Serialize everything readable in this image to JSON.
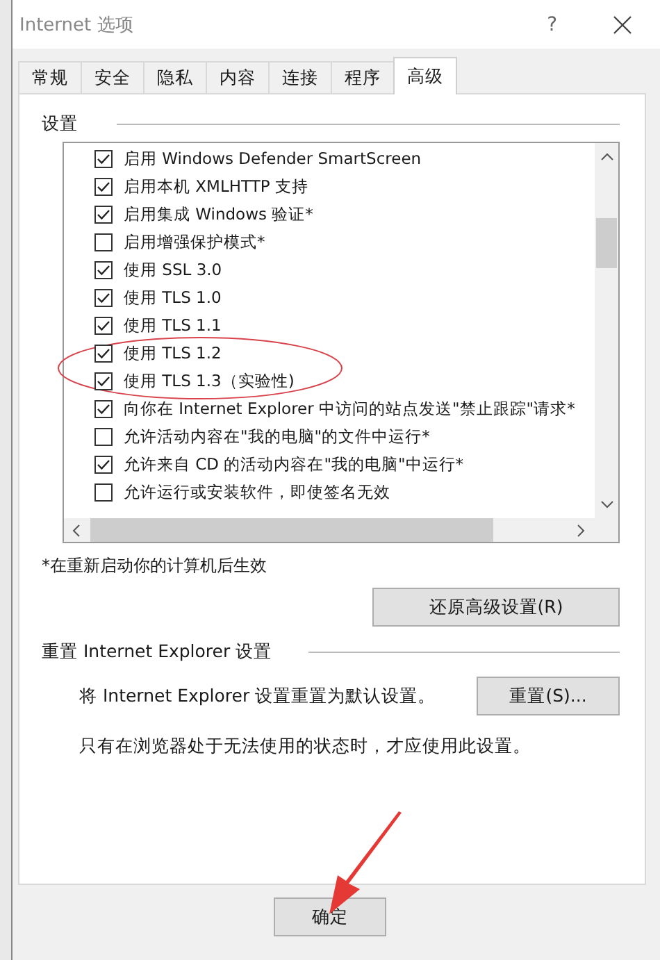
{
  "window": {
    "title": "Internet 选项",
    "help": "?"
  },
  "tabs": [
    {
      "label": "常规",
      "selected": false
    },
    {
      "label": "安全",
      "selected": false
    },
    {
      "label": "隐私",
      "selected": false
    },
    {
      "label": "内容",
      "selected": false
    },
    {
      "label": "连接",
      "selected": false
    },
    {
      "label": "程序",
      "selected": false
    },
    {
      "label": "高级",
      "selected": true
    }
  ],
  "settings": {
    "title": "设置",
    "items": [
      {
        "label": "启用 Windows Defender SmartScreen",
        "checked": true
      },
      {
        "label": "启用本机 XMLHTTP 支持",
        "checked": true
      },
      {
        "label": "启用集成 Windows 验证*",
        "checked": true
      },
      {
        "label": "启用增强保护模式*",
        "checked": false
      },
      {
        "label": "使用 SSL 3.0",
        "checked": true
      },
      {
        "label": "使用 TLS 1.0",
        "checked": true
      },
      {
        "label": "使用 TLS 1.1",
        "checked": true
      },
      {
        "label": "使用 TLS 1.2",
        "checked": true
      },
      {
        "label": "使用 TLS 1.3（实验性)",
        "checked": true
      },
      {
        "label": "向你在 Internet Explorer 中访问的站点发送\"禁止跟踪\"请求*",
        "checked": true
      },
      {
        "label": "允许活动内容在\"我的电脑\"的文件中运行*",
        "checked": false
      },
      {
        "label": "允许来自 CD 的活动内容在\"我的电脑\"中运行*",
        "checked": true
      },
      {
        "label": "允许运行或安装软件，即使签名无效",
        "checked": false
      }
    ],
    "footnote": "*在重新启动你的计算机后生效",
    "restore_button": "还原高级设置(R)"
  },
  "reset": {
    "title": "重置 Internet Explorer 设置",
    "description": "将 Internet Explorer 设置重置为默认设置。",
    "button": "重置(S)...",
    "note": "只有在浏览器处于无法使用的状态时，才应使用此设置。"
  },
  "buttons": [
    {
      "label": "确定"
    }
  ]
}
